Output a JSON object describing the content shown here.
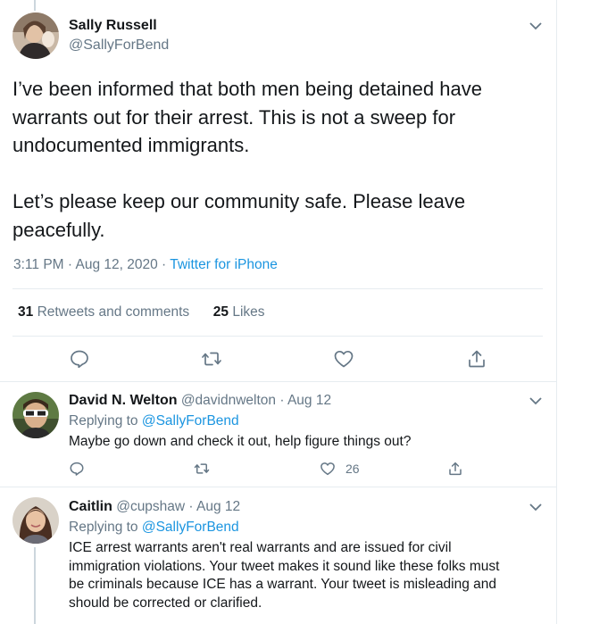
{
  "main_tweet": {
    "author_name": "Sally Russell",
    "author_handle": "@SallyForBend",
    "text_lines": [
      "I’ve been informed that both men being detained have",
      "warrants out for their arrest. This is not a sweep for",
      "undocumented immigrants.",
      "",
      "Let’s please keep our community safe. Please leave",
      "peacefully."
    ],
    "time": "3:11 PM · Aug 12, 2020 · ",
    "source": "Twitter for iPhone",
    "retweets_count": "31",
    "retweets_label": "Retweets and comments",
    "likes_count": "25",
    "likes_label": "Likes",
    "icons": [
      "reply-icon",
      "retweet-icon",
      "like-icon",
      "share-icon"
    ]
  },
  "replies": [
    {
      "author_name": "David N. Welton",
      "author_handle": "@davidnwelton",
      "date": " · Aug 12",
      "replying_prefix": "Replying to ",
      "replying_to": "@SallyForBend",
      "text_lines": [
        "Maybe go down and check it out, help figure things out?"
      ],
      "like_count": "26"
    },
    {
      "author_name": "Caitlin",
      "author_handle": "@cupshaw",
      "date": " · Aug 12",
      "replying_prefix": "Replying to ",
      "replying_to": "@SallyForBend",
      "text_lines": [
        "ICE arrest warrants aren't real warrants and are issued for civil",
        "immigration violations.  Your tweet makes it sound like these folks must",
        "be criminals because ICE has a warrant. Your tweet is misleading and",
        "should be corrected or clarified."
      ]
    }
  ],
  "colors": {
    "accent": "#1b95e0",
    "muted": "#657786",
    "text": "#14171a",
    "border": "#e6ecf0"
  }
}
